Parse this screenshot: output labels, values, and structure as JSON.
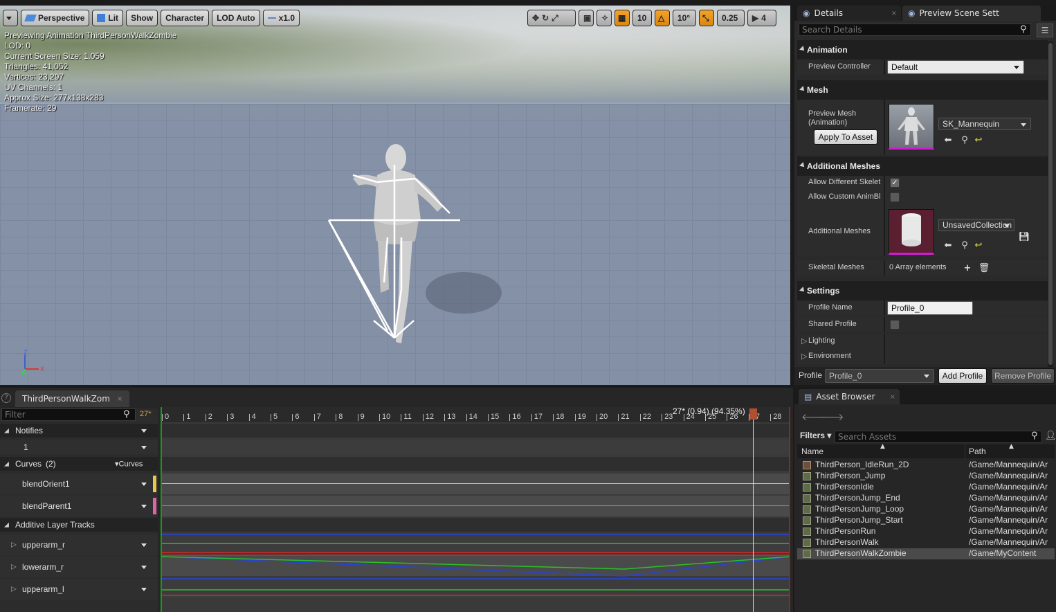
{
  "viewport": {
    "toolbar": {
      "menu_label": "",
      "perspective": "Perspective",
      "lit": "Lit",
      "show": "Show",
      "character": "Character",
      "lod": "LOD Auto",
      "speed": "x1.0",
      "grid_size": "10",
      "rotation_snap": "10°",
      "scale_snap": "0.25",
      "camera_speed": "4"
    },
    "stats": [
      "Previewing Animation ThirdPersonWalkZombie",
      "LOD: 0",
      "Current Screen Size: 1.059",
      "Triangles: 41,052",
      "Vertices: 23,297",
      "UV Channels: 1",
      "Approx Size: 277x138x283",
      "Framerate: 29"
    ],
    "axis": {
      "z": "Z",
      "x": "X",
      "y": "Y"
    }
  },
  "details": {
    "tabs": [
      "Details",
      "Preview Scene Sett"
    ],
    "search_placeholder": "Search Details",
    "sections": {
      "animation": "Animation",
      "mesh": "Mesh",
      "additional_meshes": "Additional Meshes",
      "settings": "Settings"
    },
    "preview_controller": {
      "label": "Preview Controller",
      "value": "Default"
    },
    "preview_mesh": {
      "label_line1": "Preview Mesh",
      "label_line2": "(Animation)",
      "value": "SK_Mannequin",
      "apply_button": "Apply To Asset"
    },
    "allow_diff_skel": {
      "label": "Allow Different Skelet",
      "checked": true
    },
    "allow_custom_anim": {
      "label": "Allow Custom AnimBl",
      "checked": false
    },
    "additional_meshes": {
      "label": "Additional Meshes",
      "value": "UnsavedCollection"
    },
    "skeletal_meshes": {
      "label": "Skeletal Meshes",
      "value": "0 Array elements"
    },
    "profile_name": {
      "label": "Profile Name",
      "value": "Profile_0"
    },
    "shared_profile": {
      "label": "Shared Profile",
      "checked": false
    },
    "lighting": "Lighting",
    "environment": "Environment",
    "profile_bar": {
      "label": "Profile",
      "value": "Profile_0",
      "add": "Add Profile",
      "remove": "Remove Profile"
    }
  },
  "timeline": {
    "tab": "ThirdPersonWalkZom",
    "filter_placeholder": "Filter",
    "current_frame": "27*",
    "playhead_label": "27* (0.94) (94.35%)",
    "ticks": [
      "0",
      "1",
      "2",
      "3",
      "4",
      "5",
      "6",
      "7",
      "8",
      "9",
      "10",
      "11",
      "12",
      "13",
      "14",
      "15",
      "16",
      "17",
      "18",
      "19",
      "20",
      "21",
      "22",
      "23",
      "24",
      "25",
      "26",
      "27",
      "28"
    ],
    "notifies": "Notifies",
    "notify_track": "1",
    "curves": "Curves",
    "curves_count": "(2)",
    "curves_menu": "Curves",
    "curve_tracks": [
      {
        "name": "blendOrient1",
        "color": "#e8c84a"
      },
      {
        "name": "blendParent1",
        "color": "#e062a8"
      }
    ],
    "additive": "Additive Layer Tracks",
    "additive_tracks": [
      "upperarm_r",
      "lowerarm_r",
      "upperarm_l"
    ]
  },
  "assets": {
    "tab": "Asset Browser",
    "filters": "Filters",
    "search_placeholder": "Search Assets",
    "col_name": "Name",
    "col_path": "Path",
    "rows": [
      {
        "name": "ThirdPerson_IdleRun_2D",
        "path": "/Game/Mannequin/Ar"
      },
      {
        "name": "ThirdPerson_Jump",
        "path": "/Game/Mannequin/Ar"
      },
      {
        "name": "ThirdPersonIdle",
        "path": "/Game/Mannequin/Ar"
      },
      {
        "name": "ThirdPersonJump_End",
        "path": "/Game/Mannequin/Ar"
      },
      {
        "name": "ThirdPersonJump_Loop",
        "path": "/Game/Mannequin/Ar"
      },
      {
        "name": "ThirdPersonJump_Start",
        "path": "/Game/Mannequin/Ar"
      },
      {
        "name": "ThirdPersonRun",
        "path": "/Game/Mannequin/Ar"
      },
      {
        "name": "ThirdPersonWalk",
        "path": "/Game/Mannequin/Ar"
      },
      {
        "name": "ThirdPersonWalkZombie",
        "path": "/Game/MyContent"
      }
    ]
  }
}
